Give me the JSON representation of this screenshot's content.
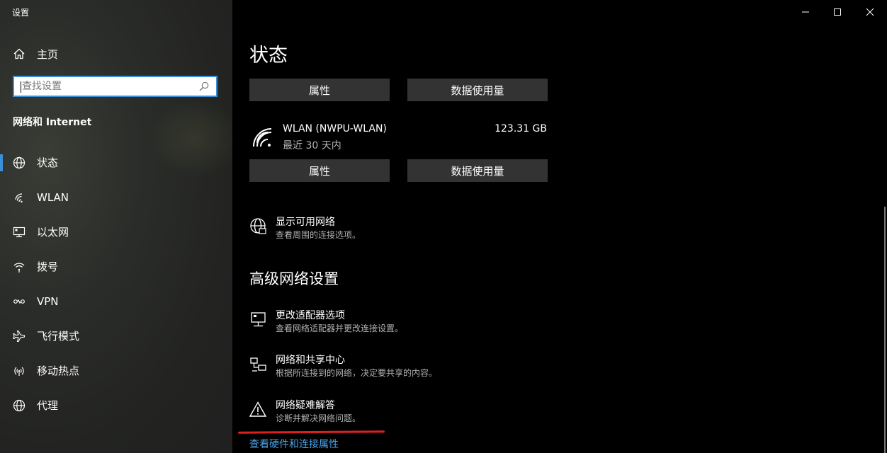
{
  "app": {
    "title": "设置"
  },
  "sidebar": {
    "home_label": "主页",
    "search": {
      "placeholder": "查找设置"
    },
    "section_title": "网络和 Internet",
    "items": [
      {
        "label": "状态",
        "icon": "globe-icon",
        "active": true
      },
      {
        "label": "WLAN",
        "icon": "wifi-icon"
      },
      {
        "label": "以太网",
        "icon": "ethernet-icon"
      },
      {
        "label": "拨号",
        "icon": "dialup-icon"
      },
      {
        "label": "VPN",
        "icon": "vpn-icon"
      },
      {
        "label": "飞行模式",
        "icon": "airplane-icon"
      },
      {
        "label": "移动热点",
        "icon": "hotspot-icon"
      },
      {
        "label": "代理",
        "icon": "globe-icon"
      }
    ]
  },
  "main": {
    "title": "状态",
    "top_buttons": {
      "properties": "属性",
      "data_usage": "数据使用量"
    },
    "network": {
      "name": "WLAN (NWPU-WLAN)",
      "period": "最近 30 天内",
      "usage": "123.31 GB",
      "properties": "属性",
      "data_usage": "数据使用量"
    },
    "show_networks": {
      "title": "显示可用网络",
      "desc": "查看周围的连接选项。"
    },
    "advanced_title": "高级网络设置",
    "advanced_items": [
      {
        "title": "更改适配器选项",
        "desc": "查看网络适配器并更改连接设置。"
      },
      {
        "title": "网络和共享中心",
        "desc": "根据所连接到的网络，决定要共享的内容。"
      },
      {
        "title": "网络疑难解答",
        "desc": "诊断并解决网络问题。"
      }
    ],
    "link": "查看硬件和连接属性"
  },
  "colors": {
    "accent": "#3b8fd8",
    "link": "#4ca3ea",
    "button_bg": "#333333",
    "annotation": "#e02020"
  }
}
